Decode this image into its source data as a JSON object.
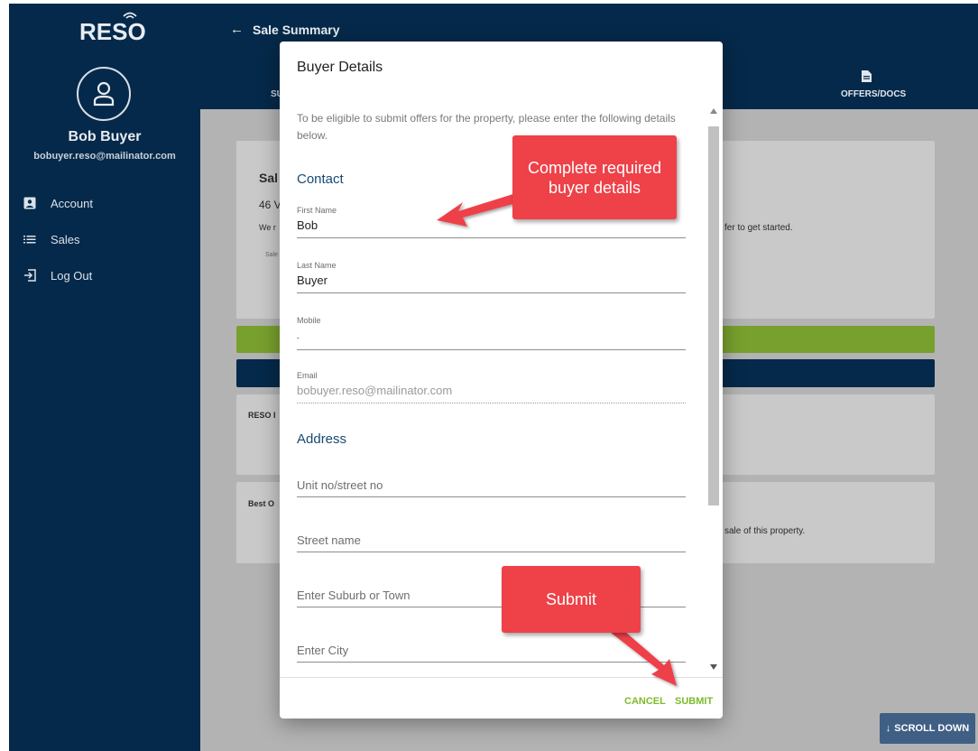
{
  "app": {
    "logo_text": "RESO"
  },
  "sidebar": {
    "user_name": "Bob Buyer",
    "user_email": "bobuyer.reso@mailinator.com",
    "items": [
      {
        "label": "Account",
        "icon": "account-box-icon"
      },
      {
        "label": "Sales",
        "icon": "list-icon"
      },
      {
        "label": "Log Out",
        "icon": "logout-icon"
      }
    ]
  },
  "header": {
    "title": "Sale Summary",
    "tabs": [
      {
        "label": "SU"
      },
      {
        "label": "OFFERS/DOCS",
        "icon": "document-icon"
      }
    ]
  },
  "background": {
    "card_title_partial": "Sal",
    "address_partial": "46 V",
    "intro_partial": "We r",
    "intro_right": "fer to get started.",
    "sale_label_partial": "Sale",
    "reso_label_partial": "RESO I",
    "best_label_partial": "Best O",
    "best_text_right": "sale of this property.",
    "scroll_down_label": "SCROLL DOWN"
  },
  "modal": {
    "title": "Buyer Details",
    "intro": "To be eligible to submit offers for the property, please enter the following details below.",
    "contact_title": "Contact",
    "fields": {
      "first_name": {
        "label": "First Name",
        "value": "Bob"
      },
      "last_name": {
        "label": "Last Name",
        "value": "Buyer"
      },
      "mobile": {
        "label": "Mobile",
        "value": "-"
      },
      "email": {
        "label": "Email",
        "value": "bobuyer.reso@mailinator.com"
      }
    },
    "address_title": "Address",
    "address_fields": {
      "unit": {
        "placeholder": "Unit no/street no"
      },
      "street": {
        "placeholder": "Street name"
      },
      "suburb": {
        "placeholder": "Enter Suburb or Town"
      },
      "city": {
        "placeholder": "Enter City"
      }
    },
    "cancel_label": "CANCEL",
    "submit_label": "SUBMIT"
  },
  "annotations": {
    "callout_details": "Complete required buyer details",
    "callout_submit": "Submit"
  },
  "colors": {
    "navy": "#05294a",
    "green": "#78a02e",
    "accent_green": "#7dbb2a",
    "callout_red": "#ee4148"
  }
}
